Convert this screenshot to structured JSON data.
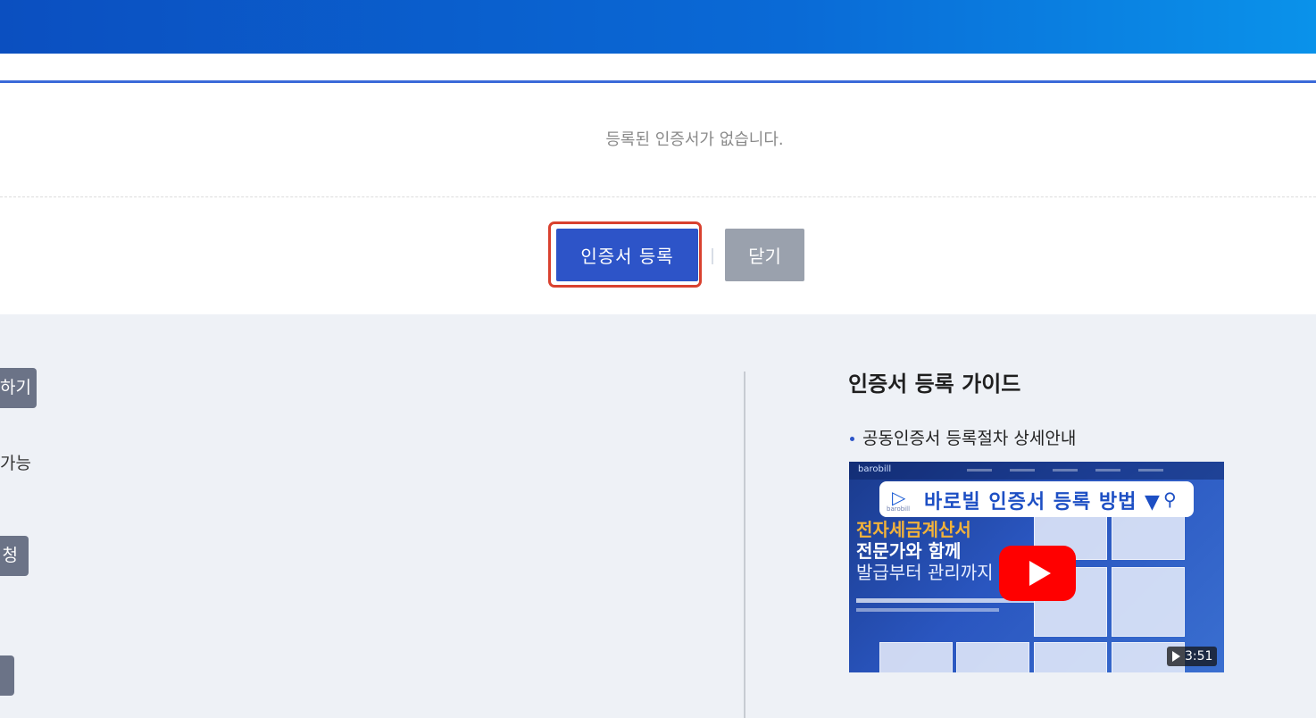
{
  "cert_panel": {
    "empty_message": "등록된 인증서가 없습니다.",
    "register_button": "인증서 등록",
    "close_button": "닫기"
  },
  "left_column": {
    "tag1": "하기",
    "text1": "가능",
    "tag2": "청",
    "tag3": ""
  },
  "guide": {
    "title": "인증서 등록 가이드",
    "link": "공동인증서 등록절차 상세안내",
    "video": {
      "brand": "barobill",
      "overlay_title": "바로빌 인증서 등록 방법 ▼",
      "logo_text": "barobill",
      "headline1": "전자세금계산서",
      "headline2": "전문가와 함께",
      "headline3": "발급부터 관리까지",
      "duration": "3:51"
    }
  },
  "colors": {
    "primary": "#2d54c8",
    "highlight": "#d9412f",
    "secondary": "#9aa1ad",
    "play": "#ff0000"
  }
}
